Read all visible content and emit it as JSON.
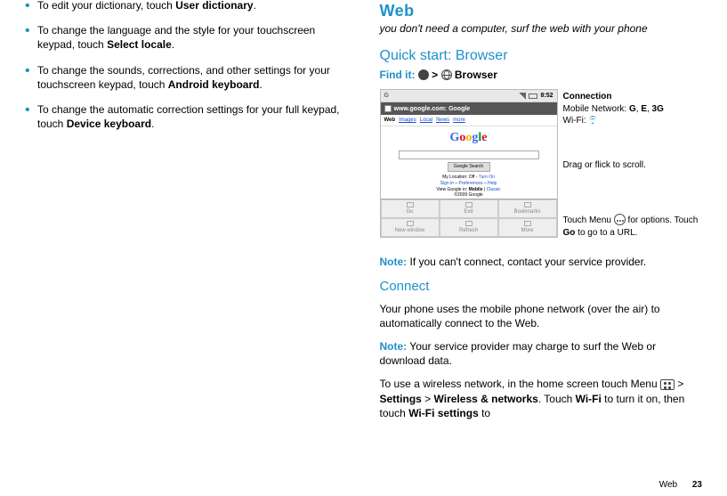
{
  "left": {
    "b1_pre": "To edit your dictionary, touch ",
    "b1_bold": "User dictionary",
    "b1_post": ".",
    "b2_pre": "To change the language and the style for your touchscreen keypad, touch ",
    "b2_bold": "Select locale",
    "b2_post": ".",
    "b3_pre": "To change the sounds, corrections, and other settings for your touchscreen keypad, touch ",
    "b3_bold": "Android keyboard",
    "b3_post": ".",
    "b4_pre": "To change the automatic correction settings for your full keypad, touch ",
    "b4_bold": "Device keyboard",
    "b4_post": "."
  },
  "right": {
    "title": "Web",
    "tagline": "you don't need a computer, surf the web with your phone",
    "qs": "Quick start: Browser",
    "findit_label": "Find it:",
    "findit_sep": " > ",
    "findit_target": "Browser",
    "mock": {
      "time": "8:52",
      "sig_letter": "G",
      "url": "www.google.com: Google",
      "tabs": {
        "web": "Web",
        "images": "Images",
        "local": "Local",
        "news": "News",
        "more": "more"
      },
      "search_btn": "Google Search",
      "loc_line_pre": "My Location: Off - ",
      "loc_line_link": "Turn On",
      "signin": "Sign in",
      "dash": " – ",
      "prefs": "Preferences",
      "help": "Help",
      "view_pre": "View Google in: ",
      "view_mobile": "Mobile",
      "view_sep": " | ",
      "view_classic": "Classic",
      "copyright": "©2009 Google",
      "menu": {
        "go": "Go",
        "exit": "Exit",
        "bookmarks": "Bookmarks",
        "newwin": "New window",
        "refresh": "Refresh",
        "more": "More"
      }
    },
    "annot": {
      "conn_title": "Connection",
      "conn_mobile_pre": "Mobile Network: ",
      "conn_g": "G",
      "conn_sep": ", ",
      "conn_e": "E",
      "conn_3g": "3G",
      "conn_wifi": "Wi-Fi: ",
      "drag": "Drag or flick to scroll.",
      "menu_pre": "Touch Menu ",
      "menu_post": " for options. Touch ",
      "menu_go": "Go",
      "menu_end": " to go to a URL."
    },
    "note1_label": "Note:",
    "note1_body": " If you can't connect, contact your service provider.",
    "connect_h": "Connect",
    "connect_p": "Your phone uses the mobile phone network (over the air) to automatically connect to the Web.",
    "note2_label": "Note:",
    "note2_body": " Your service provider may charge to surf the Web or download data.",
    "wifi_p_pre": "To use a wireless network, in the home screen touch Menu ",
    "wifi_sep1": " > ",
    "wifi_settings": "Settings",
    "wifi_sep2": " > ",
    "wifi_net": "Wireless & networks",
    "wifi_p_mid": ". Touch ",
    "wifi_wifi": "Wi-Fi",
    "wifi_p_mid2": " to turn it on, then touch ",
    "wifi_wset": "Wi-Fi settings",
    "wifi_p_end": " to"
  },
  "footer": {
    "section": "Web",
    "page": "23"
  }
}
